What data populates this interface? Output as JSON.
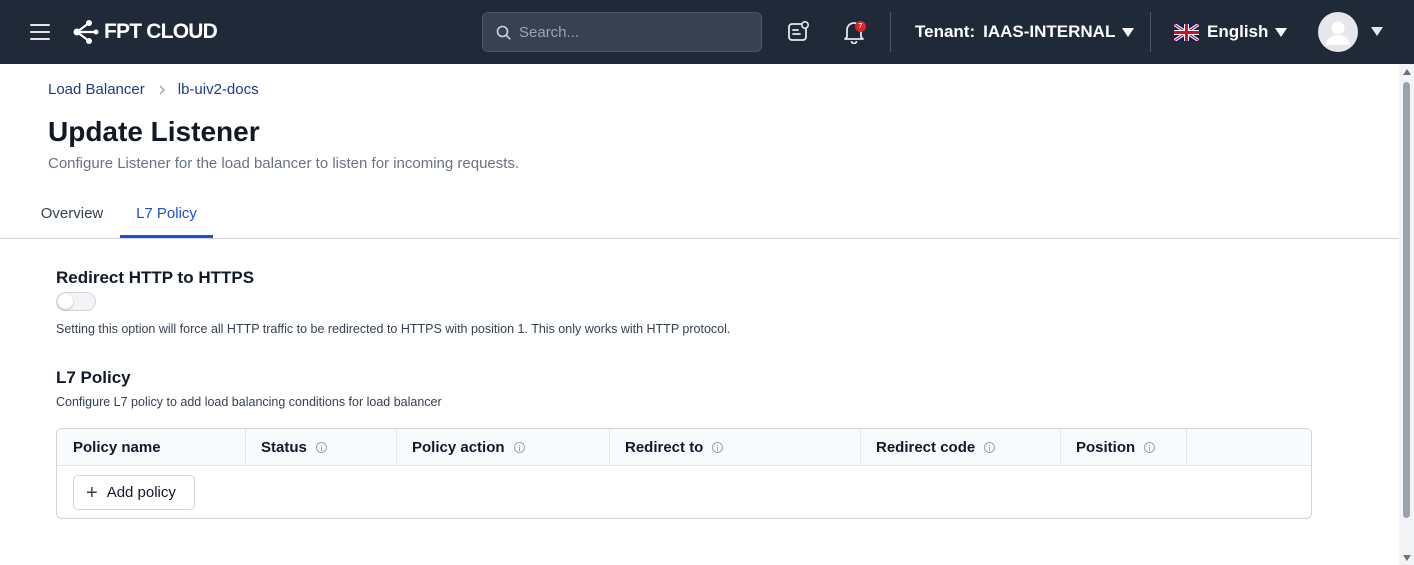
{
  "header": {
    "logo_text": "FPT CLOUD",
    "search_placeholder": "Search...",
    "notification_count": "7",
    "tenant_label": "Tenant:",
    "tenant_value": "IAAS-INTERNAL",
    "language": "English",
    "icons": {
      "menu": "hamburger-icon",
      "search": "search-icon",
      "ticket": "support-ticket-icon",
      "bell": "bell-icon",
      "flag": "uk-flag-icon",
      "avatar": "user-avatar-icon"
    },
    "colors": {
      "bar": "#1f2937",
      "badge": "#dc2626"
    }
  },
  "breadcrumb": {
    "items": [
      "Load Balancer",
      "lb-uiv2-docs"
    ]
  },
  "page": {
    "title": "Update Listener",
    "subtitle": "Configure Listener for the load balancer to listen for incoming requests."
  },
  "tabs": [
    "Overview",
    "L7 Policy"
  ],
  "active_tab": "L7 Policy",
  "redirect": {
    "title": "Redirect HTTP to HTTPS",
    "enabled": false,
    "help": "Setting this option will force all HTTP traffic to be redirected to HTTPS with position 1. This only works with HTTP protocol."
  },
  "l7_policy": {
    "title": "L7 Policy",
    "description": "Configure L7 policy to add load balancing conditions for load balancer",
    "columns": [
      "Policy name",
      "Status",
      "Policy action",
      "Redirect to",
      "Redirect code",
      "Position",
      ""
    ],
    "rows": [],
    "add_button": "Add policy"
  },
  "colors": {
    "accent": "#1d4ed8",
    "link": "#1e3a8a"
  }
}
